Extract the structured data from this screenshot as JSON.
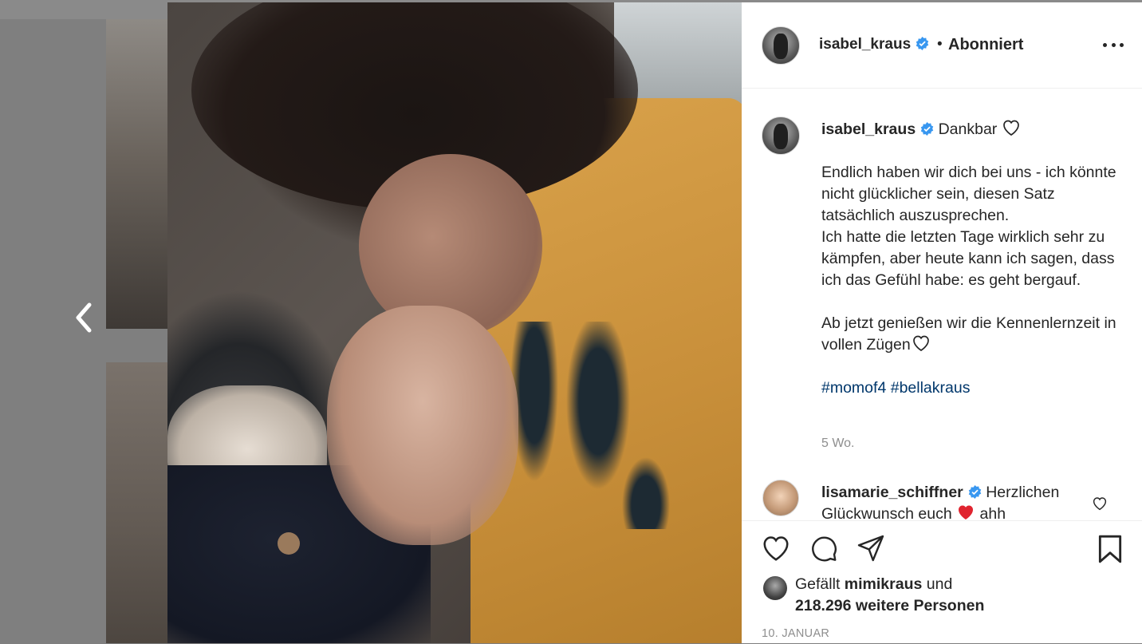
{
  "post": {
    "username": "isabel_kraus",
    "verified": true,
    "follow_separator": "•",
    "follow_status": "Abonniert"
  },
  "caption": {
    "username": "isabel_kraus",
    "title": "Dankbar",
    "paragraph1": "Endlich haben wir dich bei uns - ich könnte nicht glücklicher sein, diesen Satz tatsächlich auszusprechen.",
    "paragraph2": "Ich hatte die letzten Tage wirklich sehr zu kämpfen, aber heute kann ich sagen, dass ich das Gefühl habe: es geht bergauf.",
    "paragraph3": "Ab jetzt genießen wir die Kennenlernzeit in vollen Zügen",
    "hashtag1": "#momof4",
    "hashtag2": "#bellakraus",
    "time": "5 Wo."
  },
  "comment": {
    "username": "lisamarie_schiffner",
    "text_start": "Herzlichen Glückwunsch euch",
    "text_end": "ahh"
  },
  "likes": {
    "prefix": "Gefällt",
    "user": "mimikraus",
    "connector": "und",
    "count_text": "218.296 weitere Personen"
  },
  "date": "10. JANUAR",
  "colors": {
    "verified_blue": "#3897f0",
    "text": "#262626",
    "muted": "#8e8e8e",
    "hashtag": "#00376b",
    "heart_red": "#ed4956"
  }
}
